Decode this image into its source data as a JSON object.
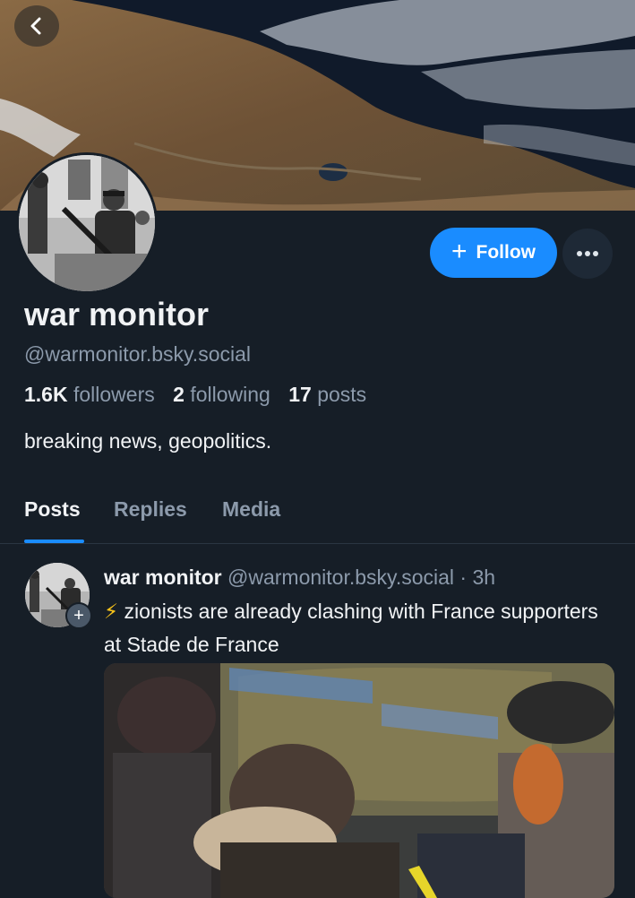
{
  "header": {
    "back_icon": "chevron-left-icon"
  },
  "profile": {
    "display_name": "war monitor",
    "handle": "@warmonitor.bsky.social",
    "followers_count": "1.6K",
    "followers_label": "followers",
    "following_count": "2",
    "following_label": "following",
    "posts_count": "17",
    "posts_label": "posts",
    "bio": "breaking news, geopolitics."
  },
  "actions": {
    "follow_label": "Follow",
    "follow_icon": "plus-icon",
    "more_icon": "ellipsis-icon"
  },
  "tabs": [
    {
      "label": "Posts",
      "active": true
    },
    {
      "label": "Replies",
      "active": false
    },
    {
      "label": "Media",
      "active": false
    }
  ],
  "post": {
    "author_name": "war monitor",
    "author_handle": "@warmonitor.bsky.social",
    "separator": "·",
    "time": "3h",
    "emoji": "⚡",
    "text": "zionists are already clashing with France supporters at Stade de France"
  },
  "colors": {
    "accent": "#1a8cff",
    "background": "#161e27",
    "muted": "#8c9aab"
  }
}
